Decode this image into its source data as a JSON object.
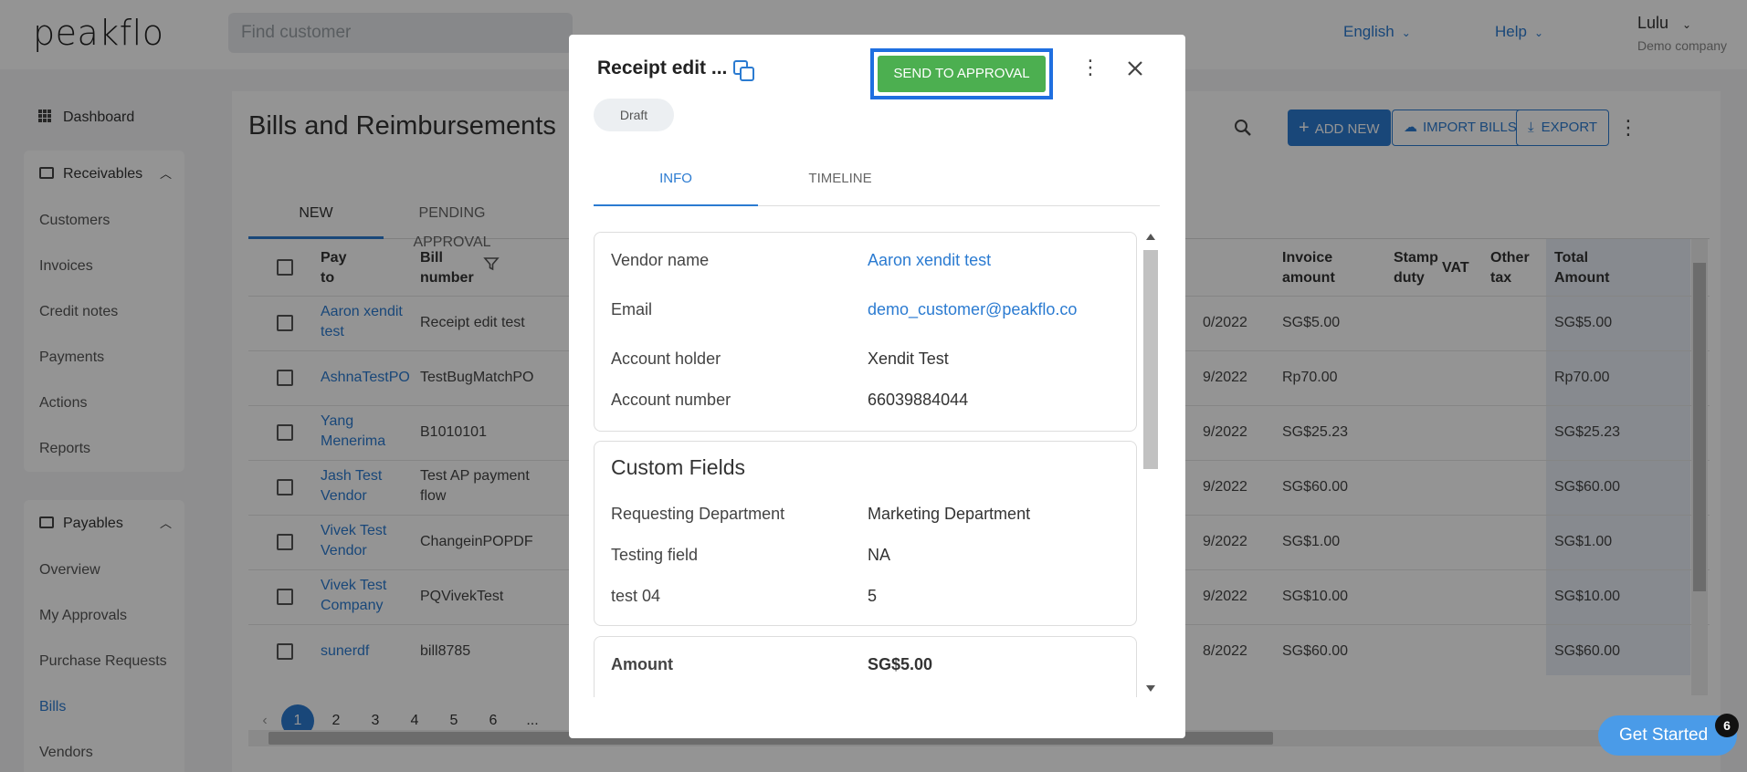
{
  "header": {
    "logo": "peakflo",
    "search_placeholder": "Find customer",
    "language": "English",
    "help": "Help",
    "user_name": "Lulu",
    "company": "Demo company"
  },
  "sidebar": {
    "dashboard": "Dashboard",
    "receivables": {
      "label": "Receivables",
      "items": [
        "Customers",
        "Invoices",
        "Credit notes",
        "Payments",
        "Actions",
        "Reports"
      ]
    },
    "payables": {
      "label": "Payables",
      "items": [
        "Overview",
        "My Approvals",
        "Purchase Requests",
        "Bills",
        "Vendors"
      ],
      "active": "Bills"
    }
  },
  "main": {
    "title": "Bills and Reimbursements",
    "buttons": {
      "add_new": "ADD NEW",
      "import_bills": "IMPORT BILLS",
      "export": "EXPORT"
    },
    "tabs": [
      "NEW",
      "PENDING APPROVAL"
    ],
    "active_tab": "NEW",
    "columns": {
      "pay_to_1": "Pay",
      "pay_to_2": "to",
      "bill_number_1": "Bill",
      "bill_number_2": "number",
      "invoice_amount_1": "Invoice",
      "invoice_amount_2": "amount",
      "stamp_duty_1": "Stamp",
      "stamp_duty_2": "duty",
      "vat": "VAT",
      "other_tax_1": "Other",
      "other_tax_2": "tax",
      "total_amount_1": "Total",
      "total_amount_2": "Amount"
    },
    "rows": [
      {
        "pay_to_1": "Aaron xendit",
        "pay_to_2": "test",
        "bill_1": "Receipt edit test",
        "bill_2": "",
        "date": "0/2022",
        "invoice": "SG$5.00",
        "total": "SG$5.00"
      },
      {
        "pay_to_1": "AshnaTestPO",
        "pay_to_2": "",
        "bill_1": "TestBugMatchPO",
        "bill_2": "",
        "date": "9/2022",
        "invoice": "Rp70.00",
        "total": "Rp70.00"
      },
      {
        "pay_to_1": "Yang",
        "pay_to_2": "Menerima",
        "bill_1": "B1010101",
        "bill_2": "",
        "date": "9/2022",
        "invoice": "SG$25.23",
        "total": "SG$25.23"
      },
      {
        "pay_to_1": "Jash Test",
        "pay_to_2": "Vendor",
        "bill_1": "Test AP payment",
        "bill_2": "flow",
        "date": "9/2022",
        "invoice": "SG$60.00",
        "total": "SG$60.00"
      },
      {
        "pay_to_1": "Vivek Test",
        "pay_to_2": "Vendor",
        "bill_1": "ChangeinPOPDF",
        "bill_2": "",
        "date": "9/2022",
        "invoice": "SG$1.00",
        "total": "SG$1.00"
      },
      {
        "pay_to_1": "Vivek Test",
        "pay_to_2": "Company",
        "bill_1": "PQVivekTest",
        "bill_2": "",
        "date": "9/2022",
        "invoice": "SG$10.00",
        "total": "SG$10.00"
      },
      {
        "pay_to_1": "sunerdf",
        "pay_to_2": "",
        "bill_1": "bill8785",
        "bill_2": "",
        "date": "8/2022",
        "invoice": "SG$60.00",
        "total": "SG$60.00"
      }
    ],
    "pagination": {
      "prev": "‹",
      "pages": [
        "1",
        "2",
        "3",
        "4",
        "5",
        "6",
        "..."
      ],
      "current": "1"
    }
  },
  "modal": {
    "title": "Receipt edit ...",
    "send_button": "SEND TO APPROVAL",
    "status": "Draft",
    "tabs": [
      "INFO",
      "TIMELINE"
    ],
    "active_tab": "INFO",
    "vendor_card": {
      "vendor_name_label": "Vendor name",
      "vendor_name": "Aaron xendit test",
      "email_label": "Email",
      "email": "demo_customer@peakflo.co",
      "account_holder_label": "Account holder",
      "account_holder": "Xendit Test",
      "account_number_label": "Account number",
      "account_number": "66039884044"
    },
    "custom_fields": {
      "title": "Custom Fields",
      "requesting_department_label": "Requesting Department",
      "requesting_department": "Marketing Department",
      "testing_field_label": "Testing field",
      "testing_field": "NA",
      "test04_label": "test 04",
      "test04": "5"
    },
    "amount_card": {
      "amount_label": "Amount",
      "amount": "SG$5.00"
    }
  },
  "get_started": {
    "label": "Get Started",
    "badge": "6"
  },
  "colors": {
    "accent": "#2b7bd1",
    "send_button": "#4caf50",
    "highlight_border": "#1f6fe0"
  }
}
